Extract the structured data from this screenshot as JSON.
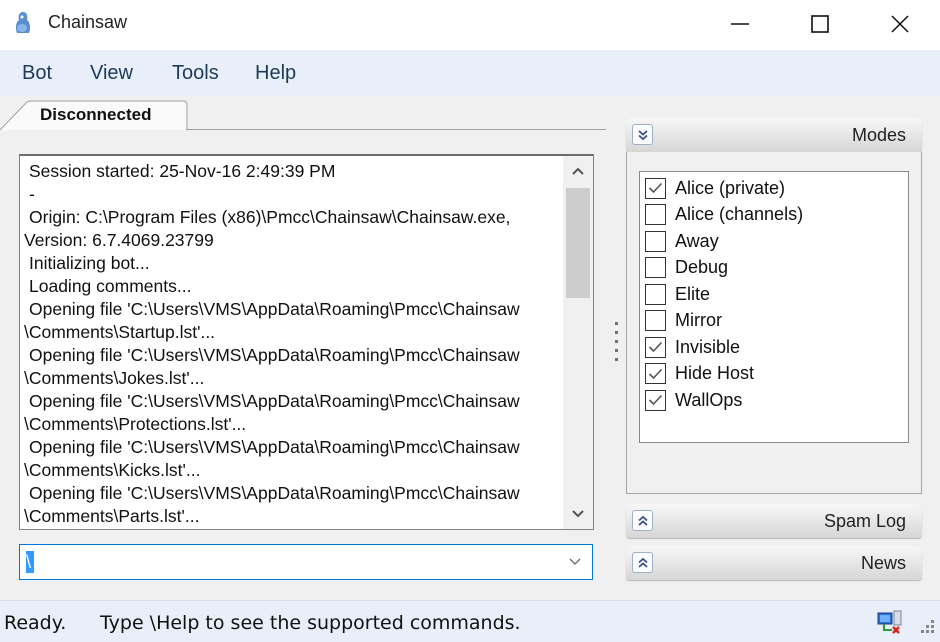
{
  "window": {
    "title": "Chainsaw",
    "app_icon": "chainsaw-app-icon",
    "controls": {
      "minimize": "minimize-icon",
      "maximize": "maximize-icon",
      "close": "close-icon"
    }
  },
  "menu": {
    "items": [
      {
        "label": "Bot"
      },
      {
        "label": "View"
      },
      {
        "label": "Tools"
      },
      {
        "label": "Help"
      }
    ]
  },
  "tabs": [
    {
      "label": "Disconnected",
      "active": true
    }
  ],
  "log": {
    "lines": [
      {
        "text": "Session started: 25-Nov-16 2:49:39 PM",
        "indent": true
      },
      {
        "text": "-",
        "indent": true
      },
      {
        "text": "Origin: C:\\Program Files (x86)\\Pmcc\\Chainsaw\\Chainsaw.exe,",
        "indent": true
      },
      {
        "text": "Version: 6.7.4069.23799",
        "indent": false
      },
      {
        "text": "Initializing bot...",
        "indent": true
      },
      {
        "text": "Loading comments...",
        "indent": true
      },
      {
        "text": "Opening file 'C:\\Users\\VMS\\AppData\\Roaming\\Pmcc\\Chainsaw",
        "indent": true
      },
      {
        "text": "\\Comments\\Startup.lst'...",
        "indent": false
      },
      {
        "text": "Opening file 'C:\\Users\\VMS\\AppData\\Roaming\\Pmcc\\Chainsaw",
        "indent": true
      },
      {
        "text": "\\Comments\\Jokes.lst'...",
        "indent": false
      },
      {
        "text": "Opening file 'C:\\Users\\VMS\\AppData\\Roaming\\Pmcc\\Chainsaw",
        "indent": true
      },
      {
        "text": "\\Comments\\Protections.lst'...",
        "indent": false
      },
      {
        "text": "Opening file 'C:\\Users\\VMS\\AppData\\Roaming\\Pmcc\\Chainsaw",
        "indent": true
      },
      {
        "text": "\\Comments\\Kicks.lst'...",
        "indent": false
      },
      {
        "text": "Opening file 'C:\\Users\\VMS\\AppData\\Roaming\\Pmcc\\Chainsaw",
        "indent": true
      },
      {
        "text": "\\Comments\\Parts.lst'...",
        "indent": false
      }
    ]
  },
  "command_input": {
    "value": "\\",
    "selected": true
  },
  "panels": {
    "modes": {
      "title": "Modes",
      "expanded": true,
      "items": [
        {
          "label": "Alice (private)",
          "checked": true
        },
        {
          "label": "Alice (channels)",
          "checked": false
        },
        {
          "label": "Away",
          "checked": false
        },
        {
          "label": "Debug",
          "checked": false
        },
        {
          "label": "Elite",
          "checked": false
        },
        {
          "label": "Mirror",
          "checked": false
        },
        {
          "label": "Invisible",
          "checked": true
        },
        {
          "label": "Hide Host",
          "checked": true
        },
        {
          "label": "WallOps",
          "checked": true
        }
      ]
    },
    "spam_log": {
      "title": "Spam Log",
      "expanded": false
    },
    "news": {
      "title": "News",
      "expanded": false
    }
  },
  "status": {
    "state": "Ready.",
    "hint": "Type \\Help to see the supported commands.",
    "connection_icon": "network-disconnected-icon"
  }
}
